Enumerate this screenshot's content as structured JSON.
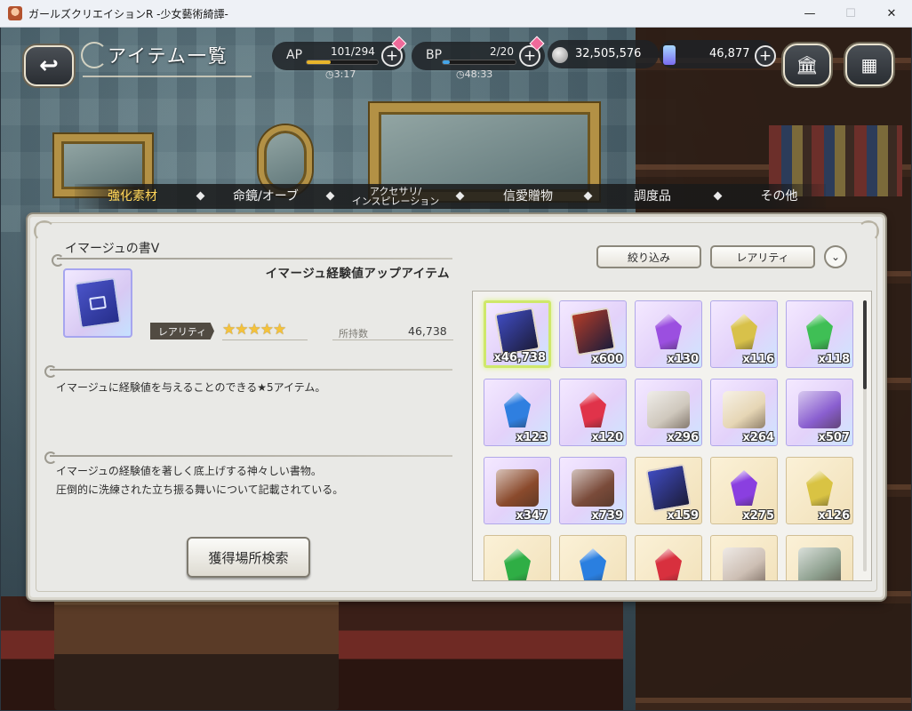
{
  "window": {
    "title": "ガールズクリエイションR -少女藝術綺譚-",
    "minimize": "—",
    "maximize": "☐",
    "close": "✕"
  },
  "header": {
    "back_icon": "↩",
    "title": "アイテム一覧",
    "ap": {
      "label": "AP",
      "value": "101/294",
      "timer": "3:17",
      "fill_fraction": 0.34,
      "color": "#e8b52b"
    },
    "bp": {
      "label": "BP",
      "value": "2/20",
      "timer": "48:33",
      "fill_fraction": 0.1,
      "color": "#46a6e8"
    },
    "plus": "+",
    "timer_icon": "◷",
    "coins": "32,505,576",
    "gems": "46,877",
    "home_icon": "🏛",
    "menu_icon": "▦"
  },
  "tabs": [
    {
      "label": "強化素材",
      "active": true
    },
    {
      "label": "命鏡/オーブ"
    },
    {
      "label_line1": "アクセサリ/",
      "label_line2": "インスピレーション"
    },
    {
      "label": "信愛贈物"
    },
    {
      "label": "調度品"
    },
    {
      "label": "その他"
    }
  ],
  "detail": {
    "name": "イマージュの書Ⅴ",
    "type": "イマージュ経験値アップアイテム",
    "rarity_label": "レアリティ",
    "stars": "★★★★★",
    "owned_label": "所持数",
    "owned_value": "46,738",
    "desc1": "イマージュに経験値を与えることのできる★5アイテム。",
    "flavor_line1": "イマージュの経験値を著しく底上げする神々しい書物。",
    "flavor_line2": "圧倒的に洗練された立ち振る舞いについて記載されている。",
    "search_button": "獲得場所検索"
  },
  "controls": {
    "filter": "絞り込み",
    "rarity": "レアリティ",
    "sort_icon": "⌄"
  },
  "items": [
    {
      "kind": "book",
      "color": "#3f4bc0",
      "count": "x46,738",
      "rarity": "r5",
      "selected": true
    },
    {
      "kind": "book",
      "color": "#b23c28",
      "count": "x600",
      "rarity": "r5"
    },
    {
      "kind": "gem",
      "color": "#9b4fe0",
      "count": "x130",
      "rarity": "r5"
    },
    {
      "kind": "gem",
      "color": "#d8c14a",
      "count": "x116",
      "rarity": "r5"
    },
    {
      "kind": "gem",
      "color": "#3fbf55",
      "count": "x118",
      "rarity": "r5"
    },
    {
      "kind": "gem",
      "color": "#2f7fe0",
      "count": "x123",
      "rarity": "r5"
    },
    {
      "kind": "gem",
      "color": "#e0334a",
      "count": "x120",
      "rarity": "r5"
    },
    {
      "kind": "statue",
      "color": "#cfc8bd",
      "count": "x296",
      "rarity": "r5"
    },
    {
      "kind": "scroll",
      "color": "#e6d6b5",
      "count": "x264",
      "rarity": "r5"
    },
    {
      "kind": "cards",
      "color": "#8a5fd0",
      "count": "x507",
      "rarity": "r5"
    },
    {
      "kind": "box",
      "color": "#8a4a2c",
      "count": "x347",
      "rarity": "r5"
    },
    {
      "kind": "tubes",
      "color": "#7a4b3a",
      "count": "x739",
      "rarity": "r5"
    },
    {
      "kind": "book",
      "color": "#3f4bc0",
      "count": "x159",
      "rarity": "r4"
    },
    {
      "kind": "gem",
      "color": "#8a3fe0",
      "count": "x275",
      "rarity": "r4"
    },
    {
      "kind": "gem",
      "color": "#d9c343",
      "count": "x126",
      "rarity": "r4"
    },
    {
      "kind": "gem",
      "color": "#2fae45",
      "count": "",
      "rarity": "r4"
    },
    {
      "kind": "gem",
      "color": "#2a7fe0",
      "count": "",
      "rarity": "r4"
    },
    {
      "kind": "gem",
      "color": "#d8303e",
      "count": "",
      "rarity": "r4"
    },
    {
      "kind": "statue",
      "color": "#cdbfb4",
      "count": "",
      "rarity": "r4"
    },
    {
      "kind": "rock",
      "color": "#8ea08f",
      "count": "",
      "rarity": "r4"
    }
  ]
}
